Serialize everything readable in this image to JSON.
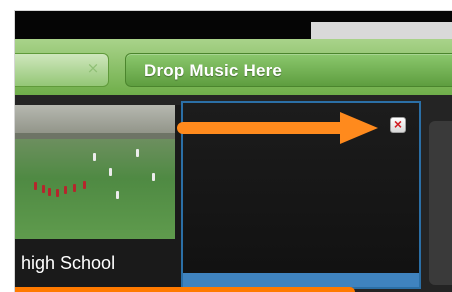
{
  "music_strip": {
    "drop_label": "Drop Music Here"
  },
  "clip": {
    "label": "high School"
  }
}
